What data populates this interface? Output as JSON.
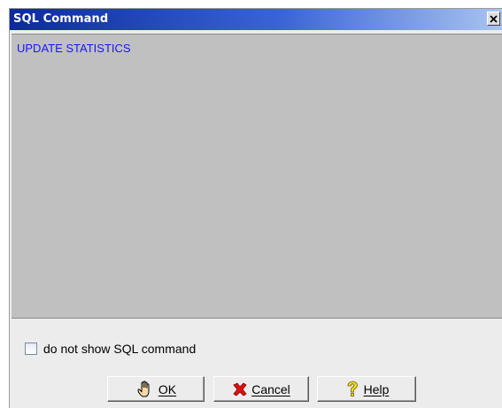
{
  "window": {
    "title": "SQL Command",
    "close_icon": "close-icon"
  },
  "sql": {
    "command": "UPDATE STATISTICS",
    "text_color": "#1717f0",
    "background": "#c0c0c0"
  },
  "options": {
    "hide_sql_label": "do not show SQL command",
    "hide_sql_checked": false
  },
  "buttons": {
    "ok_label": "OK",
    "ok_icon": "hand-pointer-icon",
    "cancel_label": "Cancel",
    "cancel_icon": "red-x-icon",
    "help_label": "Help",
    "help_icon": "question-mark-icon"
  },
  "colors": {
    "title_bar_start": "#0b2b9a",
    "title_bar_end": "#a9c4f0"
  }
}
